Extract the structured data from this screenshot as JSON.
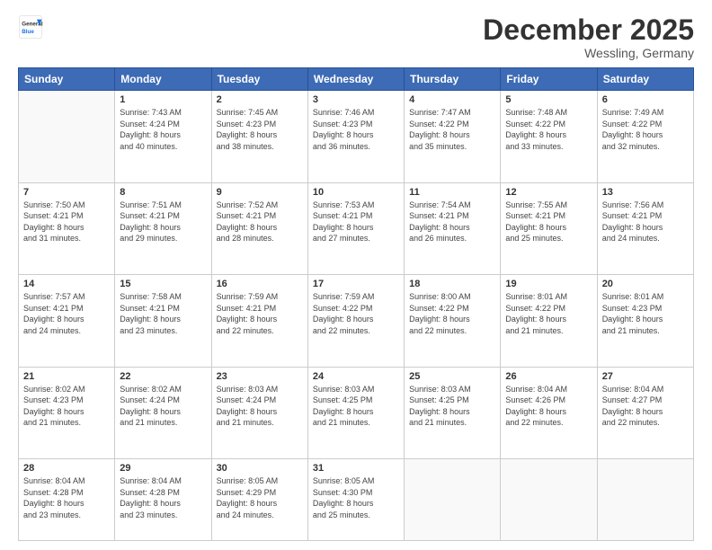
{
  "logo": {
    "general": "General",
    "blue": "Blue"
  },
  "header": {
    "month": "December 2025",
    "location": "Wessling, Germany"
  },
  "days_of_week": [
    "Sunday",
    "Monday",
    "Tuesday",
    "Wednesday",
    "Thursday",
    "Friday",
    "Saturday"
  ],
  "weeks": [
    [
      {
        "day": "",
        "info": ""
      },
      {
        "day": "1",
        "info": "Sunrise: 7:43 AM\nSunset: 4:24 PM\nDaylight: 8 hours\nand 40 minutes."
      },
      {
        "day": "2",
        "info": "Sunrise: 7:45 AM\nSunset: 4:23 PM\nDaylight: 8 hours\nand 38 minutes."
      },
      {
        "day": "3",
        "info": "Sunrise: 7:46 AM\nSunset: 4:23 PM\nDaylight: 8 hours\nand 36 minutes."
      },
      {
        "day": "4",
        "info": "Sunrise: 7:47 AM\nSunset: 4:22 PM\nDaylight: 8 hours\nand 35 minutes."
      },
      {
        "day": "5",
        "info": "Sunrise: 7:48 AM\nSunset: 4:22 PM\nDaylight: 8 hours\nand 33 minutes."
      },
      {
        "day": "6",
        "info": "Sunrise: 7:49 AM\nSunset: 4:22 PM\nDaylight: 8 hours\nand 32 minutes."
      }
    ],
    [
      {
        "day": "7",
        "info": "Sunrise: 7:50 AM\nSunset: 4:21 PM\nDaylight: 8 hours\nand 31 minutes."
      },
      {
        "day": "8",
        "info": "Sunrise: 7:51 AM\nSunset: 4:21 PM\nDaylight: 8 hours\nand 29 minutes."
      },
      {
        "day": "9",
        "info": "Sunrise: 7:52 AM\nSunset: 4:21 PM\nDaylight: 8 hours\nand 28 minutes."
      },
      {
        "day": "10",
        "info": "Sunrise: 7:53 AM\nSunset: 4:21 PM\nDaylight: 8 hours\nand 27 minutes."
      },
      {
        "day": "11",
        "info": "Sunrise: 7:54 AM\nSunset: 4:21 PM\nDaylight: 8 hours\nand 26 minutes."
      },
      {
        "day": "12",
        "info": "Sunrise: 7:55 AM\nSunset: 4:21 PM\nDaylight: 8 hours\nand 25 minutes."
      },
      {
        "day": "13",
        "info": "Sunrise: 7:56 AM\nSunset: 4:21 PM\nDaylight: 8 hours\nand 24 minutes."
      }
    ],
    [
      {
        "day": "14",
        "info": "Sunrise: 7:57 AM\nSunset: 4:21 PM\nDaylight: 8 hours\nand 24 minutes."
      },
      {
        "day": "15",
        "info": "Sunrise: 7:58 AM\nSunset: 4:21 PM\nDaylight: 8 hours\nand 23 minutes."
      },
      {
        "day": "16",
        "info": "Sunrise: 7:59 AM\nSunset: 4:21 PM\nDaylight: 8 hours\nand 22 minutes."
      },
      {
        "day": "17",
        "info": "Sunrise: 7:59 AM\nSunset: 4:22 PM\nDaylight: 8 hours\nand 22 minutes."
      },
      {
        "day": "18",
        "info": "Sunrise: 8:00 AM\nSunset: 4:22 PM\nDaylight: 8 hours\nand 22 minutes."
      },
      {
        "day": "19",
        "info": "Sunrise: 8:01 AM\nSunset: 4:22 PM\nDaylight: 8 hours\nand 21 minutes."
      },
      {
        "day": "20",
        "info": "Sunrise: 8:01 AM\nSunset: 4:23 PM\nDaylight: 8 hours\nand 21 minutes."
      }
    ],
    [
      {
        "day": "21",
        "info": "Sunrise: 8:02 AM\nSunset: 4:23 PM\nDaylight: 8 hours\nand 21 minutes."
      },
      {
        "day": "22",
        "info": "Sunrise: 8:02 AM\nSunset: 4:24 PM\nDaylight: 8 hours\nand 21 minutes."
      },
      {
        "day": "23",
        "info": "Sunrise: 8:03 AM\nSunset: 4:24 PM\nDaylight: 8 hours\nand 21 minutes."
      },
      {
        "day": "24",
        "info": "Sunrise: 8:03 AM\nSunset: 4:25 PM\nDaylight: 8 hours\nand 21 minutes."
      },
      {
        "day": "25",
        "info": "Sunrise: 8:03 AM\nSunset: 4:25 PM\nDaylight: 8 hours\nand 21 minutes."
      },
      {
        "day": "26",
        "info": "Sunrise: 8:04 AM\nSunset: 4:26 PM\nDaylight: 8 hours\nand 22 minutes."
      },
      {
        "day": "27",
        "info": "Sunrise: 8:04 AM\nSunset: 4:27 PM\nDaylight: 8 hours\nand 22 minutes."
      }
    ],
    [
      {
        "day": "28",
        "info": "Sunrise: 8:04 AM\nSunset: 4:28 PM\nDaylight: 8 hours\nand 23 minutes."
      },
      {
        "day": "29",
        "info": "Sunrise: 8:04 AM\nSunset: 4:28 PM\nDaylight: 8 hours\nand 23 minutes."
      },
      {
        "day": "30",
        "info": "Sunrise: 8:05 AM\nSunset: 4:29 PM\nDaylight: 8 hours\nand 24 minutes."
      },
      {
        "day": "31",
        "info": "Sunrise: 8:05 AM\nSunset: 4:30 PM\nDaylight: 8 hours\nand 25 minutes."
      },
      {
        "day": "",
        "info": ""
      },
      {
        "day": "",
        "info": ""
      },
      {
        "day": "",
        "info": ""
      }
    ]
  ]
}
